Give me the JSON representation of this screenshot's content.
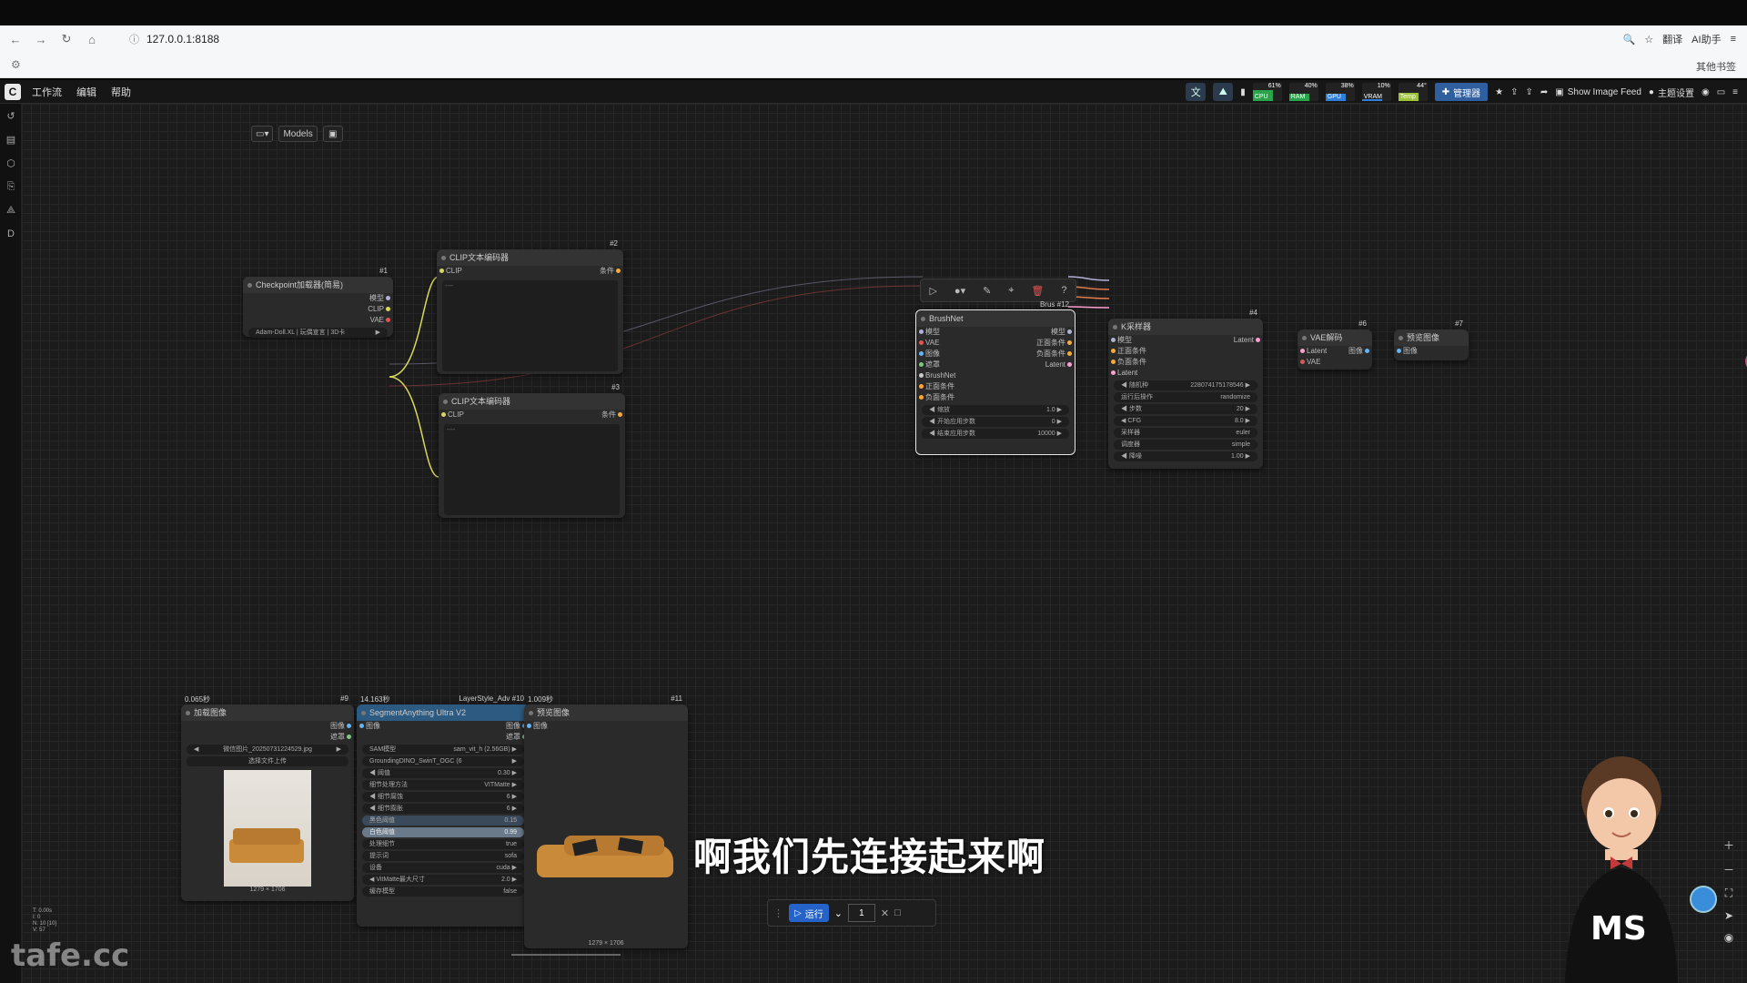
{
  "browser": {
    "url": "127.0.0.1:8188",
    "bookmarks_right": "其他书签",
    "right_items": [
      "翻译",
      "AI助手"
    ]
  },
  "app": {
    "menu": [
      "工作流",
      "编辑",
      "帮助"
    ],
    "meters": [
      {
        "label": "CPU",
        "pct": "61%",
        "color": "#2aa34a"
      },
      {
        "label": "RAM",
        "pct": "40%",
        "color": "#2aa34a"
      },
      {
        "label": "GPU",
        "pct": "38%",
        "color": "#2f7fd8"
      },
      {
        "label": "VRAM",
        "pct": "10%",
        "color": "#2f7fd8"
      },
      {
        "label": "Temp",
        "pct": "44°",
        "color": "#9cc23a"
      }
    ],
    "manager": "管理器",
    "show_image_feed": "Show Image Feed",
    "theme": "主题设置"
  },
  "canvas_toolbar": {
    "models": "Models"
  },
  "nodes": {
    "checkpoint": {
      "id": "#1",
      "title": "Checkpoint加载器(简易)",
      "outputs": [
        "模型",
        "CLIP",
        "VAE"
      ],
      "ckpt": "Adam-Doll.XL | 玩偶宣言 | 3D卡"
    },
    "clip1": {
      "id": "#2",
      "title": "CLIP文本编码器",
      "input": "CLIP",
      "output": "条件"
    },
    "clip2": {
      "id": "#3",
      "title": "CLIP文本编码器",
      "input": "CLIP",
      "output": "条件"
    },
    "brushnet": {
      "id": "#12",
      "tag": "Brus",
      "title": "BrushNet",
      "inputs": [
        "模型",
        "VAE",
        "图像",
        "遮罩",
        "BrushNet",
        "正面条件",
        "负面条件"
      ],
      "outputs": [
        "模型",
        "正面条件",
        "负面条件",
        "Latent"
      ],
      "widgets": [
        {
          "label": "缩放",
          "value": "1.0"
        },
        {
          "label": "开始应用步数",
          "value": "0"
        },
        {
          "label": "结束应用步数",
          "value": "10000"
        }
      ]
    },
    "ksampler": {
      "id": "#4",
      "title": "K采样器",
      "inputs": [
        "模型",
        "正面条件",
        "负面条件",
        "Latent"
      ],
      "output": "Latent",
      "widgets": [
        {
          "label": "随机种",
          "value": "228074175178546"
        },
        {
          "label": "运行后操作",
          "value": "randomize"
        },
        {
          "label": "步数",
          "value": "20"
        },
        {
          "label": "CFG",
          "value": "8.0"
        },
        {
          "label": "采样器",
          "value": "euler"
        },
        {
          "label": "调度器",
          "value": "simple"
        },
        {
          "label": "降噪",
          "value": "1.00"
        }
      ]
    },
    "vaedecode": {
      "id": "#6",
      "title": "VAE解码",
      "inputs": [
        "Latent",
        "VAE"
      ],
      "output": "图像"
    },
    "preview7": {
      "id": "#7",
      "title": "预览图像",
      "input": "图像"
    },
    "loadimage": {
      "id": "#9",
      "time": "0.065秒",
      "title": "加载图像",
      "outputs": [
        "图像",
        "遮罩"
      ],
      "file": "微信图片_20250731224529.jpg",
      "upload": "选择文件上传",
      "dims": "1279 × 1706"
    },
    "segment": {
      "id": "#10",
      "time": "14.163秒",
      "tag": "LayerStyle_Adv",
      "title": "SegmentAnything Ultra V2",
      "input": "图像",
      "outputs": [
        "图像",
        "遮罩"
      ],
      "widgets": [
        {
          "label": "SAM模型",
          "value": "sam_vit_h (2.56GB)"
        },
        {
          "label": "GroundingDINO_SwinT_OGC (6",
          "value": ""
        },
        {
          "label": "阈值",
          "value": "0.30"
        },
        {
          "label": "细节处理方法",
          "value": "VITMatte"
        },
        {
          "label": "细节腐蚀",
          "value": "6"
        },
        {
          "label": "细节膨胀",
          "value": "6"
        },
        {
          "label": "黑色阈值",
          "value": "0.15"
        },
        {
          "label": "白色阈值",
          "value": "0.99"
        },
        {
          "label": "处理细节",
          "value": "true"
        },
        {
          "label": "提示词",
          "value": "sofa"
        },
        {
          "label": "设备",
          "value": "cuda"
        },
        {
          "label": "VitMatte最大尺寸",
          "value": "2.0"
        },
        {
          "label": "缓存模型",
          "value": "false"
        }
      ]
    },
    "preview11": {
      "id": "#11",
      "time": "1.009秒",
      "title": "预览图像",
      "input": "图像",
      "dims": "1279 × 1706"
    }
  },
  "runbar": {
    "run": "运行",
    "count": "1"
  },
  "subtitle": "啊我们先连接起来啊",
  "watermark": "tafe.cc",
  "avatar_text": "MS"
}
